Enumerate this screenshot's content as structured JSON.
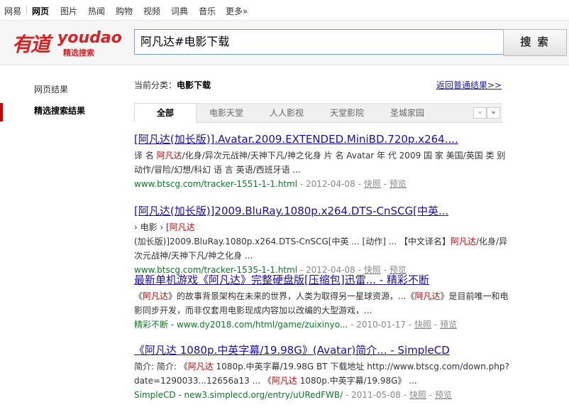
{
  "topnav": {
    "items": [
      "网易",
      "网页",
      "图片",
      "热闻",
      "购物",
      "视频",
      "词典",
      "音乐",
      "更多»"
    ],
    "active_index": 1
  },
  "brand": {
    "logo_cn": "有道",
    "logo_en": "youdao",
    "logo_sub": "精选搜索"
  },
  "search": {
    "query": "阿凡达#电影下载",
    "button_label": "搜 索"
  },
  "sidebar": {
    "items": [
      "网页结果",
      "精选搜索结果"
    ],
    "active_index": 1
  },
  "category": {
    "label": "当前分类：",
    "value": "电影下载",
    "back_link": "返回普通结果>>"
  },
  "tabs": {
    "items": [
      "全部",
      "电影天堂",
      "人人影视",
      "天堂影院",
      "圣城家园"
    ],
    "active_index": 0,
    "prev": "«",
    "next": "»"
  },
  "results": [
    {
      "title": "[阿凡达(加长版)].Avatar.2009.EXTENDED.MiniBD.720p.x264....",
      "snippet_parts": [
        {
          "t": "译 名 "
        },
        {
          "t": "阿凡达",
          "h": true
        },
        {
          "t": "/化身/异次元战神/天神下凡/神之化身 片 名 Avatar 年 代 2009 国 家 美国/英国 类 别 动作/冒险/幻想/科幻 语 言 英语/西班牙语 ..."
        }
      ],
      "url": "www.btscg.com/tracker-1551-1-1.html",
      "date": "2012-04-08",
      "cache": "快照",
      "preview": "预览"
    },
    {
      "title": "[阿凡达(加长版)]2009.BluRay.1080p.x264.DTS-CnSCG[中英...",
      "snippet_parts": [
        {
          "t": "› 电影 › ["
        },
        {
          "t": "阿凡达",
          "h": true
        },
        {
          "t": "(加长版)]2009.BluRay.1080p.x264.DTS-CnSCG[中英 ... [动作] ... 【中文译名】"
        },
        {
          "t": "阿凡达",
          "h": true
        },
        {
          "t": "/化身/异次元战神/天神下凡/神之化身 ..."
        }
      ],
      "url": "www.btscg.com/tracker-1535-1-1.html",
      "date": "2012-04-08",
      "cache": "快照",
      "preview": "预览"
    },
    {
      "title": "最新单机游戏《阿凡达》完整硬盘版[压缩包]迅雷... - 精彩不断",
      "snippet_parts": [
        {
          "t": "《"
        },
        {
          "t": "阿凡达",
          "h": true
        },
        {
          "t": "》的故事背景架构在未来的世界，人类为取得另一星球资源，...《"
        },
        {
          "t": "阿凡达",
          "h": true
        },
        {
          "t": "》是目前唯一和电影同步开发，而非仅套用电影现成内容加以改编的大型游戏，..."
        }
      ],
      "url": "精彩不断 - www.dy2018.com/html/game/zuixinyo...",
      "date": "2010-01-17",
      "cache": "快照",
      "preview": "预览"
    },
    {
      "title": "《阿凡达 1080p.中英字幕/19.98G》(Avatar)简介... - SimpleCD",
      "snippet_parts": [
        {
          "t": "简介: 简介: 《"
        },
        {
          "t": "阿凡达",
          "h": true
        },
        {
          "t": " 1080p.中英字幕/19.98G BT 下载地址 http://www.btscg.com/down.php?date=1290033...12656a13 ... 《"
        },
        {
          "t": "阿凡达",
          "h": true
        },
        {
          "t": " 1080p.中英字幕/19.98G》 ..."
        }
      ],
      "url": "SimpleCD - new3.simplecd.org/entry/uURedFWB/",
      "date": "2011-05-08",
      "cache": "快照",
      "preview": "预览"
    }
  ]
}
